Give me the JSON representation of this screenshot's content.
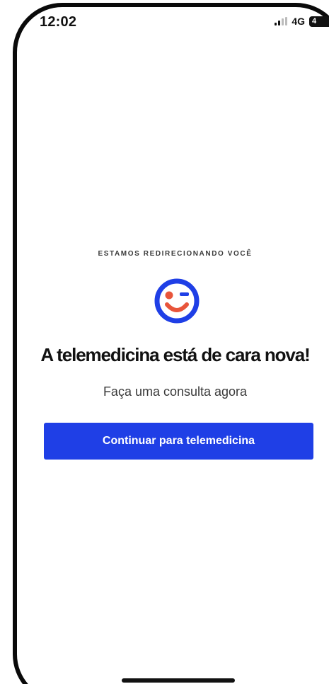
{
  "status_bar": {
    "time": "12:02",
    "network": "4G",
    "battery": "4"
  },
  "main": {
    "eyebrow": "ESTAMOS REDIRECIONANDO VOCÊ",
    "logo_icon": "winking-smiley-icon",
    "headline": "A telemedicina está de cara nova!",
    "subtitle": "Faça uma consulta agora",
    "cta_label": "Continuar para telemedicina"
  },
  "colors": {
    "primary": "#1f3fe6",
    "logo_accent": "#e8553b",
    "text": "#111111",
    "background": "#ffffff"
  }
}
